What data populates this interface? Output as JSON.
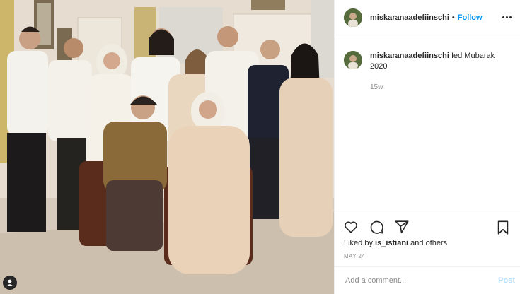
{
  "post": {
    "username": "miskaranaadefiinschi",
    "follow_label": "Follow",
    "dot": "•",
    "caption": "Ied Mubarak 2020",
    "time_ago": "15w",
    "likes_prefix": "Liked by ",
    "liked_by": "is_istiani",
    "likes_suffix": " and others",
    "date": "MAY 24"
  },
  "comment": {
    "placeholder": "Add a comment...",
    "post_label": "Post"
  },
  "icons": {
    "like": "heart-icon",
    "comment": "comment-icon",
    "share": "share-icon",
    "save": "bookmark-icon",
    "more": "more-options-icon",
    "tagged": "tagged-user-icon"
  },
  "colors": {
    "accent": "#0095f6",
    "post_disabled": "#b2dffc",
    "muted": "#8e8e8e"
  }
}
